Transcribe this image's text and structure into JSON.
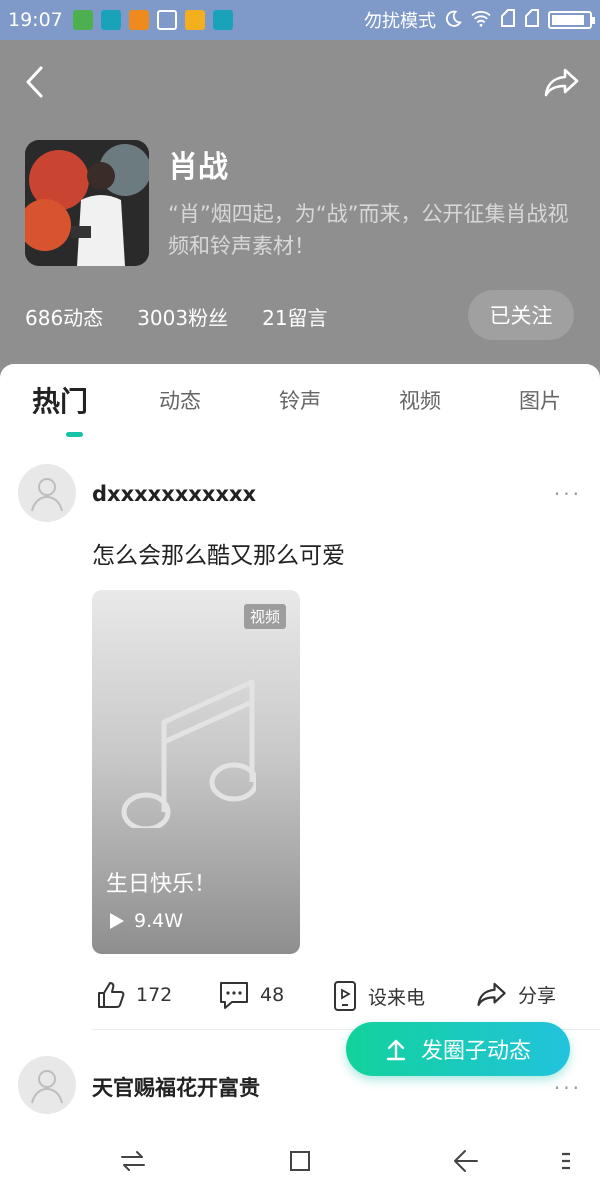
{
  "status_bar": {
    "time": "19:07",
    "dnd_label": "勿扰模式",
    "battery_level": 0.9
  },
  "header": {
    "title": "肖战",
    "description": "“肖”烟四起，为“战”而来，公开征集肖战视频和铃声素材！",
    "stats": {
      "posts": "686动态",
      "fans": "3003粉丝",
      "messages": "21留言"
    },
    "follow_label": "已关注"
  },
  "tabs": [
    {
      "label": "热门",
      "active": true
    },
    {
      "label": "动态",
      "active": false
    },
    {
      "label": "铃声",
      "active": false
    },
    {
      "label": "视频",
      "active": false
    },
    {
      "label": "图片",
      "active": false
    }
  ],
  "posts": [
    {
      "username": "dxxxxxxxxxxx",
      "text": "怎么会那么酷又那么可爱",
      "video": {
        "tag": "视频",
        "title": "生日快乐！",
        "plays": "9.4W"
      },
      "actions": {
        "likes": "172",
        "comments": "48",
        "ringtone_label": "设来电",
        "share_label": "分享"
      }
    },
    {
      "username": "天官赐福花开富贵"
    }
  ],
  "fab": {
    "label": "发圈子动态"
  },
  "colors": {
    "accent": "#17c3a5",
    "fab_start": "#12d29b",
    "fab_end": "#22c3dd",
    "status_bar": "#7f9ac9",
    "header_bg": "#8f8f8f"
  },
  "icons": {
    "back": "chevron-left-icon",
    "share": "share-arrow-icon",
    "like": "thumbs-up-icon",
    "comment": "comment-bubble-icon",
    "ringtone": "phone-ringtone-icon",
    "upload": "upload-arrow-icon"
  }
}
